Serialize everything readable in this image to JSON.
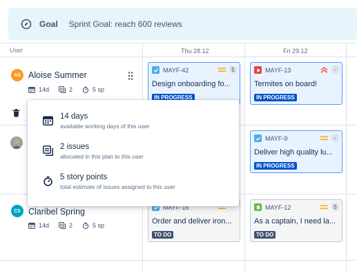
{
  "goal": {
    "label": "Goal",
    "text": "Sprint Goal: reach 600 reviews"
  },
  "grid": {
    "user_label": "User",
    "columns": [
      "Thu 28.12",
      "Fri 29.12"
    ]
  },
  "users": [
    {
      "initials": "AS",
      "name": "Aloise Summer",
      "color": "#ff991f",
      "days": "14d",
      "issues": "2",
      "sp": "5 sp"
    },
    {
      "initials": "",
      "name": "",
      "color": "#8993a4"
    },
    {
      "initials": "CS",
      "name": "Claribel Spring",
      "color": "#00a3bf",
      "days": "14d",
      "issues": "2",
      "sp": "5 sp"
    }
  ],
  "cards": [
    {
      "key": "MAYF-42",
      "title": "Design onboarding fo...",
      "status": "IN PROGRESS",
      "estimate": "5",
      "type": "task",
      "priority": "medium"
    },
    {
      "key": "MAYF-13",
      "title": "Termites on board!",
      "status": "IN PROGRESS",
      "estimate": "-",
      "type": "bug",
      "priority": "highest"
    },
    {
      "key": "MAYF-9",
      "title": "Deliver high quality lu...",
      "status": "IN PROGRESS",
      "estimate": "-",
      "type": "task",
      "priority": "medium"
    },
    {
      "key": "MAYF-16",
      "title": "Order and deliver iron...",
      "status": "TO DO",
      "estimate": "",
      "type": "task",
      "priority": "medium"
    },
    {
      "key": "MAYF-12",
      "title": "As a captain, I need la...",
      "status": "TO DO",
      "estimate": "5",
      "type": "story",
      "priority": "medium"
    }
  ],
  "popup": {
    "items": [
      {
        "title": "14 days",
        "desc": "available working days of this user",
        "icon": "calendar-icon"
      },
      {
        "title": "2 issues",
        "desc": "allocated in this plan to this user",
        "icon": "issues-icon"
      },
      {
        "title": "5 story points",
        "desc": "total estimate of issues assigned to this user",
        "icon": "stopwatch-icon"
      }
    ]
  },
  "colors": {
    "goal_bg": "#e6f4fb",
    "in_progress": "#0052cc",
    "todo": "#42526e",
    "selected_border": "#4c9aff",
    "task": "#4bade8",
    "bug": "#e5493a",
    "story": "#65ba43",
    "medium": "#ffab00",
    "highest": "#ff5630"
  }
}
